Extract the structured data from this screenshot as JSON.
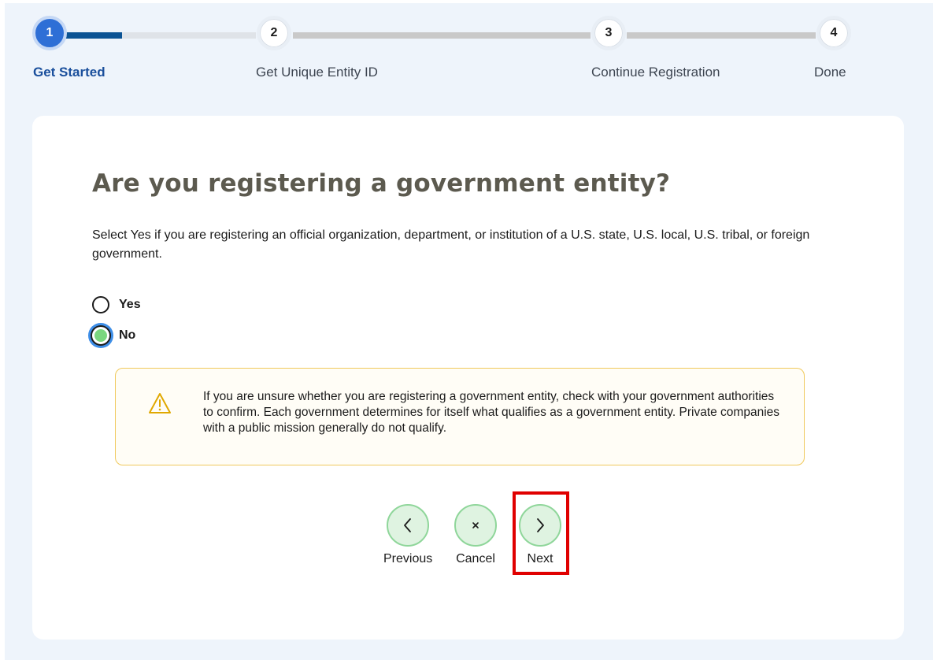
{
  "stepper": {
    "steps": [
      {
        "number": "1",
        "label": "Get Started",
        "state": "active"
      },
      {
        "number": "2",
        "label": "Get Unique Entity ID",
        "state": "upcoming"
      },
      {
        "number": "3",
        "label": "Continue Registration",
        "state": "upcoming"
      },
      {
        "number": "4",
        "label": "Done",
        "state": "upcoming"
      }
    ]
  },
  "question": {
    "heading": "Are you registering a government entity?",
    "intro": "Select Yes if you are registering an official organization, department, or institution of a U.S. state, U.S. local, U.S. tribal, or foreign government.",
    "options": [
      {
        "label": "Yes",
        "selected": false
      },
      {
        "label": "No",
        "selected": true
      }
    ]
  },
  "alert": {
    "icon": "warning-triangle-icon",
    "text": "If you are unsure whether you are registering a government entity, check with your government authorities to confirm. Each government determines for itself what qualifies as a government entity. Private companies with a public mission generally do not qualify."
  },
  "actions": {
    "previous_label": "Previous",
    "cancel_label": "Cancel",
    "next_label": "Next"
  },
  "colors": {
    "active_step": "#2e6fd6",
    "action_button_bg": "#dff3e1",
    "alert_border": "#f0c95c",
    "highlight": "#e00000"
  }
}
